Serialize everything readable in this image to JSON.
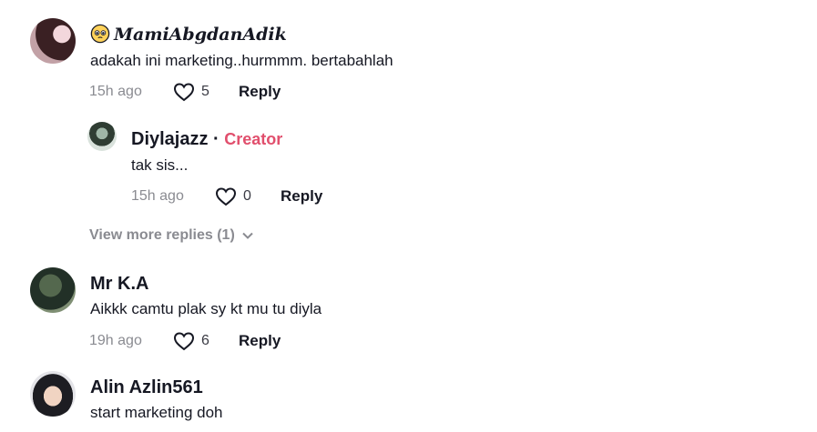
{
  "comments": [
    {
      "username": "MamiAbgdanAdik",
      "text": "adakah ini marketing..hurmmm. bertabahlah",
      "time": "15h ago",
      "likes": "5",
      "reply_label": "Reply"
    },
    {
      "username": "Diylajazz",
      "creator_sep": "·",
      "creator_label": "Creator",
      "text": "tak sis...",
      "time": "15h ago",
      "likes": "0",
      "reply_label": "Reply"
    },
    {
      "username": "Mr K.A",
      "text": "Aikkk camtu plak sy kt mu tu diyla",
      "time": "19h ago",
      "likes": "6",
      "reply_label": "Reply"
    },
    {
      "username": "Alin Azlin561",
      "text": "start marketing doh"
    }
  ],
  "view_more_replies": "View more replies (1)",
  "icons": {
    "like": "heart-outline-icon",
    "expand": "chevron-down-icon",
    "emoji": "pleading-face-emoji"
  },
  "colors": {
    "creator": "#e14f6d",
    "muted": "#8a8b91",
    "text": "#161823"
  }
}
